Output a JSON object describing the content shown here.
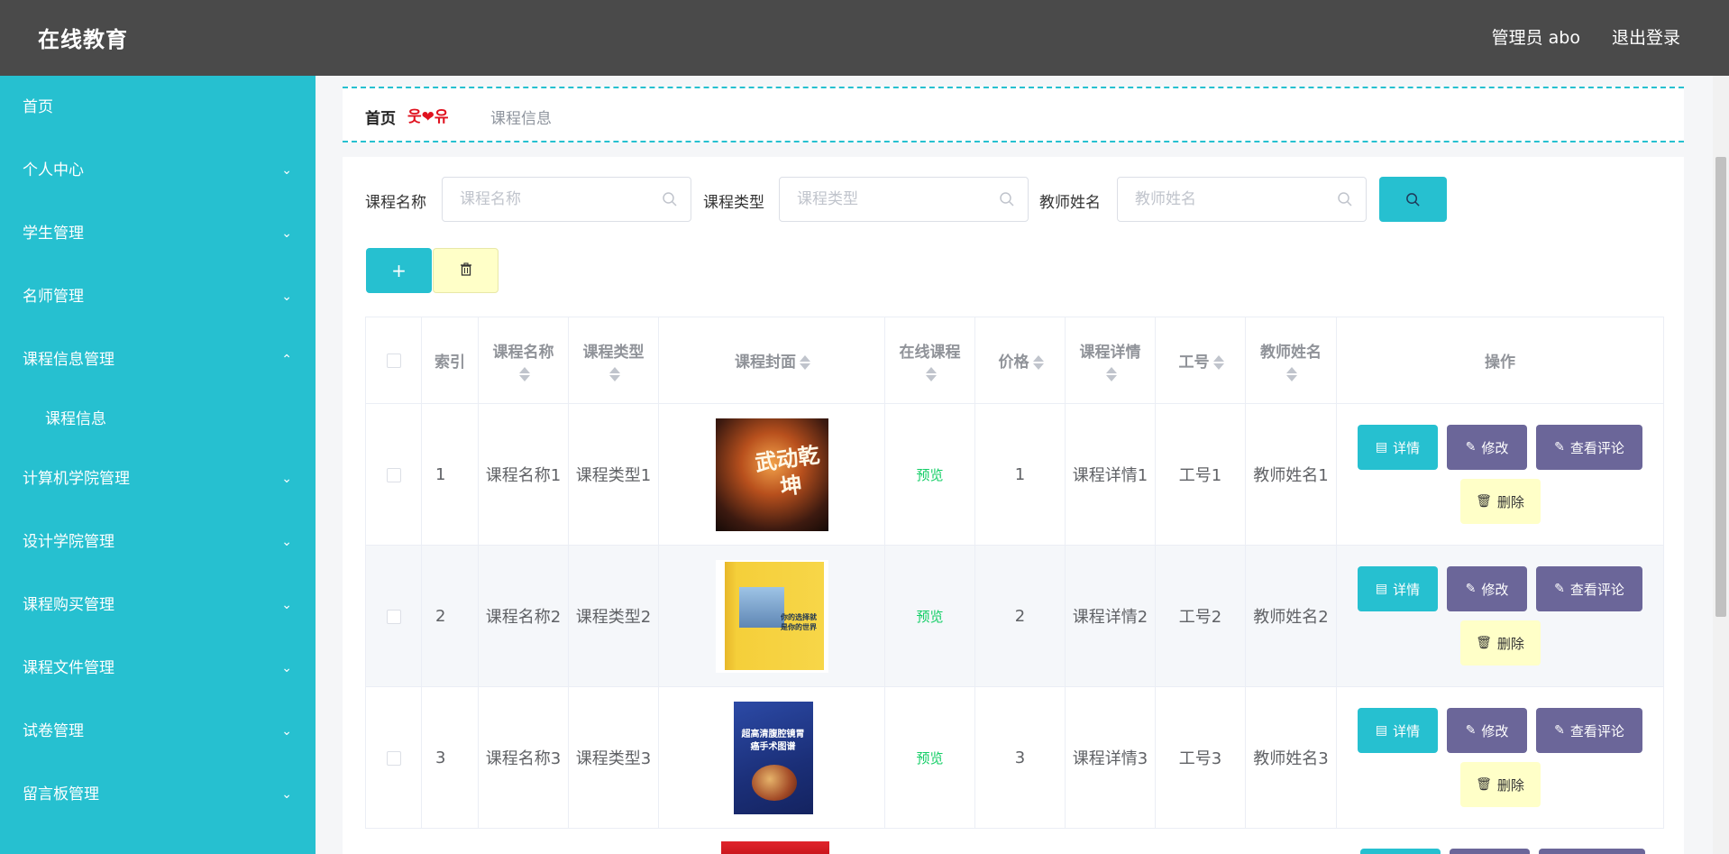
{
  "header": {
    "brand": "在线教育",
    "user": "管理员 abo",
    "logout": "退出登录"
  },
  "sidebar": {
    "items": [
      {
        "label": "首页",
        "expandable": false
      },
      {
        "label": "个人中心",
        "expandable": true
      },
      {
        "label": "学生管理",
        "expandable": true
      },
      {
        "label": "名师管理",
        "expandable": true
      },
      {
        "label": "课程信息管理",
        "expandable": true,
        "expanded": true
      },
      {
        "label": "课程信息",
        "sub": true
      },
      {
        "label": "计算机学院管理",
        "expandable": true
      },
      {
        "label": "设计学院管理",
        "expandable": true
      },
      {
        "label": "课程购买管理",
        "expandable": true
      },
      {
        "label": "课程文件管理",
        "expandable": true
      },
      {
        "label": "试卷管理",
        "expandable": true
      },
      {
        "label": "留言板管理",
        "expandable": true
      }
    ]
  },
  "breadcrumb": {
    "home": "首页",
    "separator": "웃❤유",
    "current": "课程信息"
  },
  "search": {
    "name_label": "课程名称",
    "name_placeholder": "课程名称",
    "type_label": "课程类型",
    "type_placeholder": "课程类型",
    "teacher_label": "教师姓名",
    "teacher_placeholder": "教师姓名"
  },
  "toolbar": {
    "add_label": "+",
    "delete_icon": "trash-icon"
  },
  "table": {
    "columns": [
      "",
      "索引",
      "课程名称",
      "课程类型",
      "课程封面",
      "在线课程",
      "价格",
      "课程详情",
      "工号",
      "教师姓名",
      "操作"
    ],
    "rows": [
      {
        "index": "1",
        "name": "课程名称1",
        "type": "课程类型1",
        "cover": "武动乾坤",
        "online": "预览",
        "price": "1",
        "detail": "课程详情1",
        "job_no": "工号1",
        "teacher": "教师姓名1"
      },
      {
        "index": "2",
        "name": "课程名称2",
        "type": "课程类型2",
        "cover": "你的选择就是你的世界",
        "online": "预览",
        "price": "2",
        "detail": "课程详情2",
        "job_no": "工号2",
        "teacher": "教师姓名2"
      },
      {
        "index": "3",
        "name": "课程名称3",
        "type": "课程类型3",
        "cover": "超高清腹腔镜胃癌手术图谱",
        "online": "预览",
        "price": "3",
        "detail": "课程详情3",
        "job_no": "工号3",
        "teacher": "教师姓名3"
      }
    ],
    "actions": {
      "detail": "详情",
      "edit": "修改",
      "review": "查看评论",
      "remove": "删除"
    }
  },
  "colors": {
    "accent": "#26c0d0",
    "header": "#4a4a4a",
    "purple": "#6b6699",
    "pale_yellow": "#ffffc8",
    "preview_green": "#13ce66"
  }
}
